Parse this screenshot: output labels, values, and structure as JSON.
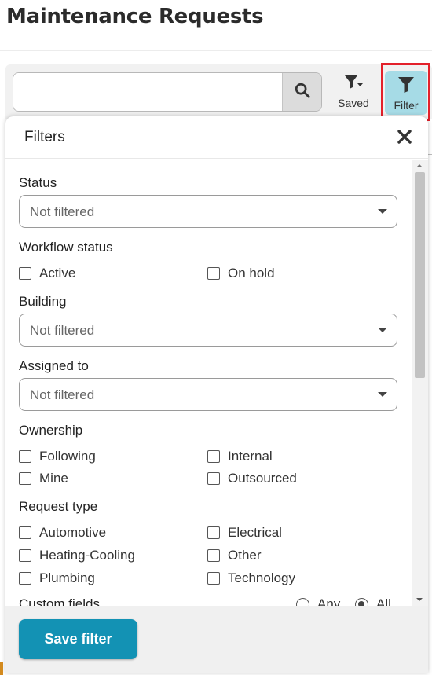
{
  "page": {
    "title": "Maintenance Requests"
  },
  "toolbar": {
    "search": {
      "value": "",
      "placeholder": ""
    },
    "saved_label": "Saved",
    "filter_label": "Filter"
  },
  "filters": {
    "title": "Filters",
    "status": {
      "label": "Status",
      "value": "Not filtered"
    },
    "workflow_status": {
      "label": "Workflow status",
      "options": [
        {
          "label": "Active",
          "checked": false
        },
        {
          "label": "On hold",
          "checked": false
        }
      ]
    },
    "building": {
      "label": "Building",
      "value": "Not filtered"
    },
    "assigned_to": {
      "label": "Assigned to",
      "value": "Not filtered"
    },
    "ownership": {
      "label": "Ownership",
      "options": [
        {
          "label": "Following",
          "checked": false
        },
        {
          "label": "Internal",
          "checked": false
        },
        {
          "label": "Mine",
          "checked": false
        },
        {
          "label": "Outsourced",
          "checked": false
        }
      ]
    },
    "request_type": {
      "label": "Request type",
      "options": [
        {
          "label": "Automotive",
          "checked": false
        },
        {
          "label": "Electrical",
          "checked": false
        },
        {
          "label": "Heating-Cooling",
          "checked": false
        },
        {
          "label": "Other",
          "checked": false
        },
        {
          "label": "Plumbing",
          "checked": false
        },
        {
          "label": "Technology",
          "checked": false
        }
      ]
    },
    "custom_fields": {
      "label": "Custom fields",
      "match_options": [
        {
          "label": "Any",
          "selected": false
        },
        {
          "label": "All",
          "selected": true
        }
      ]
    },
    "save_label": "Save filter"
  },
  "colors": {
    "filter_button_bg": "#a6dbe6",
    "highlight": "#e3202a",
    "save_button_bg": "#1392b4"
  },
  "icons": {
    "search": "search-icon",
    "saved": "saved-filter-icon",
    "filter": "filter-icon",
    "close": "close-icon"
  }
}
